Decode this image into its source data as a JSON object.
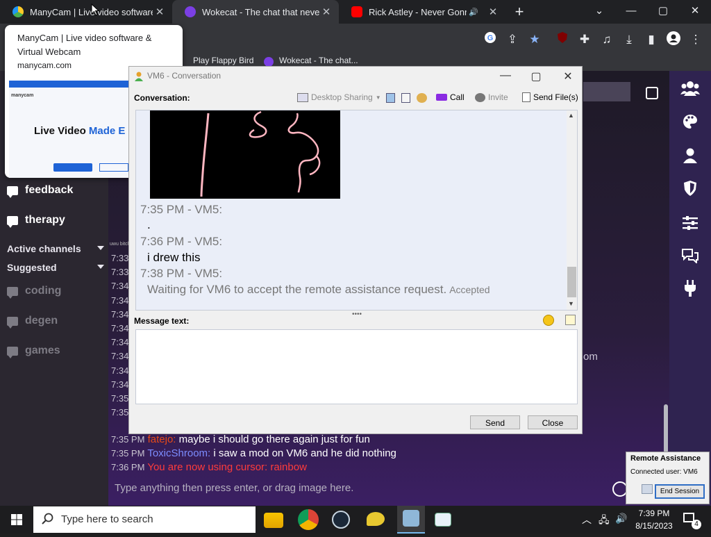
{
  "browser": {
    "tabs": [
      {
        "title": "ManyCam | Live video software & Virtual Webcam",
        "close": "✕",
        "favicon_color": "#ffca28"
      },
      {
        "title": "Wokecat - The chat that never sleeps",
        "close": "✕",
        "favicon_color": "#7b3fe4"
      },
      {
        "title": "Rick Astley - Never Gonna Give You Up",
        "close": "✕",
        "favicon_color": "#ff0000"
      }
    ],
    "new_tab": "+",
    "window": {
      "minimize": "—",
      "maximize": "▢",
      "close": "✕",
      "tablist": "⌄"
    },
    "bookmarks": [
      "Play Flappy Bird",
      "Wokecat - The chat..."
    ],
    "toolbar_icons": [
      "google-icon",
      "share-icon",
      "star-icon",
      "ublock-icon",
      "extensions-icon",
      "media-icon",
      "download-icon",
      "sidepanel-icon",
      "profile-icon",
      "menu-icon"
    ]
  },
  "tooltip": {
    "title": "ManyCam | Live video software & Virtual Webcam",
    "url": "manycam.com",
    "thumb_headline_a": "Live Video ",
    "thumb_headline_b": "Made E",
    "thumb_logo": "manycam"
  },
  "sidebar": {
    "channels": [
      "feedback",
      "therapy"
    ],
    "section_active": "Active channels",
    "section_suggested": "Suggested",
    "suggested": [
      "coding",
      "degen",
      "games"
    ]
  },
  "chat": {
    "timestamps": [
      "7:33",
      "7:33",
      "7:34",
      "7:34",
      "7:34",
      "7:34",
      "7:34",
      "7:34",
      "7:34",
      "7:34",
      "7:35",
      "7:35"
    ],
    "small_note": "uwu bitch",
    "lines": [
      {
        "time": "7:35 PM",
        "user": "fatejo:",
        "text": " maybe i should go there again just for fun",
        "color": "#e64a19"
      },
      {
        "time": "7:35 PM",
        "user": "ToxicShroom:",
        "text": " i saw a mod on VM6 and he did nothing",
        "color": "#7c8cff"
      },
      {
        "time": "7:36 PM",
        "user": "",
        "text": "You are now using cursor: rainbow",
        "color": "#ff3b3b"
      }
    ],
    "partial_text": "om",
    "input_placeholder": "Type anything then press enter, or drag image here."
  },
  "dialog": {
    "title": "VM6 - Conversation",
    "conversation_label": "Conversation:",
    "toolbar": {
      "desktop_sharing": "Desktop Sharing",
      "call": "Call",
      "invite": "Invite",
      "send_files": "Send File(s)"
    },
    "messages": [
      {
        "header": "7:35 PM - VM5:",
        "text": "."
      },
      {
        "header": "7:36 PM - VM5:",
        "text": "i drew this"
      },
      {
        "header": "7:38 PM - VM5:",
        "text": "Waiting for VM6 to accept the remote assistance request.",
        "status": "Accepted"
      }
    ],
    "message_label": "Message text:",
    "message_value": "",
    "send": "Send",
    "close": "Close"
  },
  "remote_assistance": {
    "title": "Remote Assistance",
    "connected": "Connected user:  VM6",
    "end_session": "End Session"
  },
  "taskbar": {
    "search_placeholder": "Type here to search",
    "time": "7:39 PM",
    "date": "8/15/2023",
    "notifications": "4"
  }
}
